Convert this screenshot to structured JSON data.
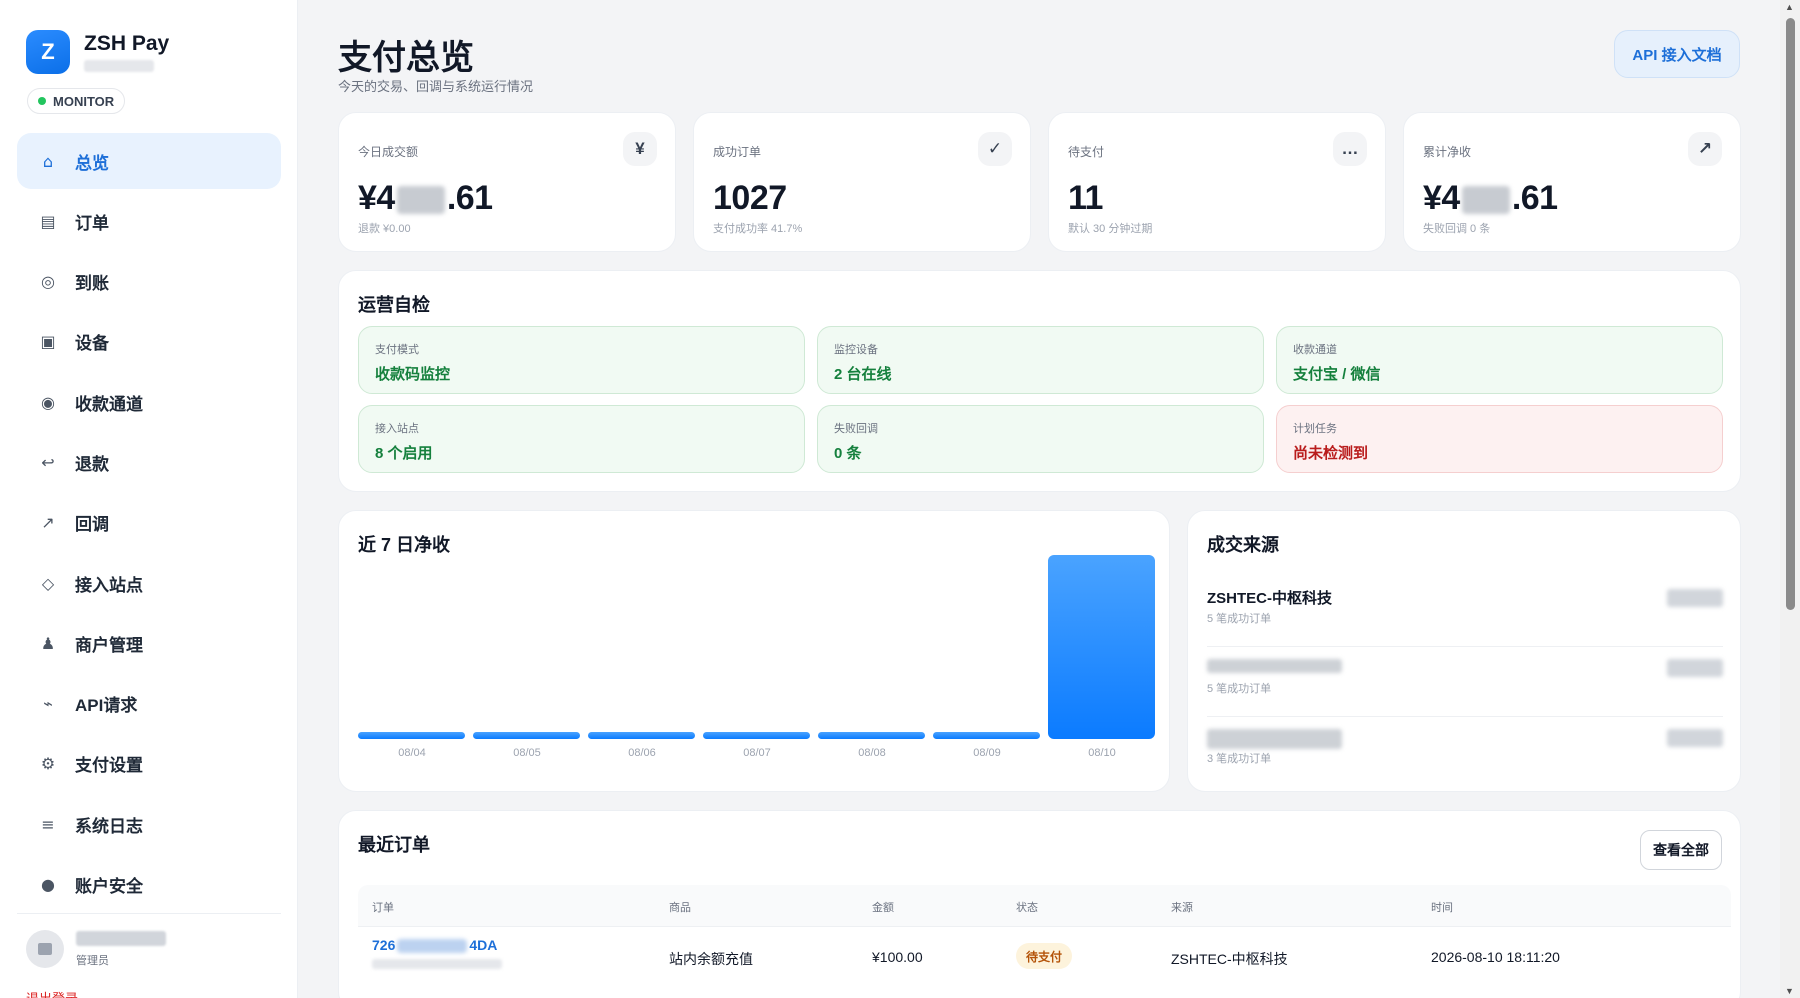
{
  "brand": {
    "logo_letter": "Z",
    "name": "ZSH Pay",
    "badge": "MONITOR"
  },
  "nav": [
    {
      "icon": "⌂",
      "label": "总览",
      "active": true
    },
    {
      "icon": "▤",
      "label": "订单"
    },
    {
      "icon": "◎",
      "label": "到账"
    },
    {
      "icon": "▣",
      "label": "设备"
    },
    {
      "icon": "◉",
      "label": "收款通道"
    },
    {
      "icon": "↩",
      "label": "退款"
    },
    {
      "icon": "↗",
      "label": "回调"
    },
    {
      "icon": "◇",
      "label": "接入站点"
    },
    {
      "icon": "♟",
      "label": "商户管理"
    },
    {
      "icon": "⌁",
      "label": "API请求"
    },
    {
      "icon": "⚙",
      "label": "支付设置"
    },
    {
      "icon": "≡",
      "label": "系统日志"
    },
    {
      "icon": "●",
      "label": "账户安全"
    }
  ],
  "user": {
    "role": "管理员",
    "logout": "退出登录"
  },
  "header": {
    "title": "支付总览",
    "subtitle": "今天的交易、回调与系统运行情况",
    "api_button": "API 接入文档"
  },
  "stats": [
    {
      "label": "今日成交额",
      "icon": "¥",
      "value_prefix": "¥4",
      "value_suffix": ".61",
      "note": "退款 ¥0.00"
    },
    {
      "label": "成功订单",
      "icon": "✓",
      "value": "1027",
      "note": "支付成功率 41.7%"
    },
    {
      "label": "待支付",
      "icon": "…",
      "value": "11",
      "note": "默认 30 分钟过期"
    },
    {
      "label": "累计净收",
      "icon": "↗",
      "value_prefix": "¥4",
      "value_suffix": ".61",
      "note": "失败回调 0 条"
    }
  ],
  "ops": {
    "title": "运营自检",
    "items": [
      {
        "label": "支付模式",
        "value": "收款码监控",
        "status": "ok"
      },
      {
        "label": "监控设备",
        "value": "2 台在线",
        "status": "ok"
      },
      {
        "label": "收款通道",
        "value": "支付宝 / 微信",
        "status": "ok"
      },
      {
        "label": "接入站点",
        "value": "8 个启用",
        "status": "ok"
      },
      {
        "label": "失败回调",
        "value": "0 条",
        "status": "ok"
      },
      {
        "label": "计划任务",
        "value": "尚未检测到",
        "status": "bad"
      }
    ]
  },
  "chart_data": {
    "type": "bar",
    "title": "近 7 日净收",
    "categories": [
      "08/04",
      "08/05",
      "08/06",
      "08/07",
      "08/08",
      "08/09",
      "08/10"
    ],
    "values": [
      0.04,
      0.04,
      0.04,
      0.04,
      0.04,
      0.04,
      1.0
    ],
    "grid": false,
    "legend": "none"
  },
  "sources": {
    "title": "成交来源",
    "items": [
      {
        "name": "ZSHTEC-中枢科技",
        "count": "5 笔成功订单"
      },
      {
        "name": "",
        "count": "5 笔成功订单"
      },
      {
        "name": "",
        "count": "3 笔成功订单"
      }
    ]
  },
  "recent": {
    "title": "最近订单",
    "view_all": "查看全部",
    "columns": [
      "订单",
      "商品",
      "金额",
      "状态",
      "来源",
      "时间"
    ],
    "rows": [
      {
        "order_prefix": "726",
        "order_suffix": "4DA",
        "product": "站内余额充值",
        "amount": "¥100.00",
        "status": "待支付",
        "source": "ZSHTEC-中枢科技",
        "time": "2026-08-10 18:11:20"
      }
    ]
  }
}
